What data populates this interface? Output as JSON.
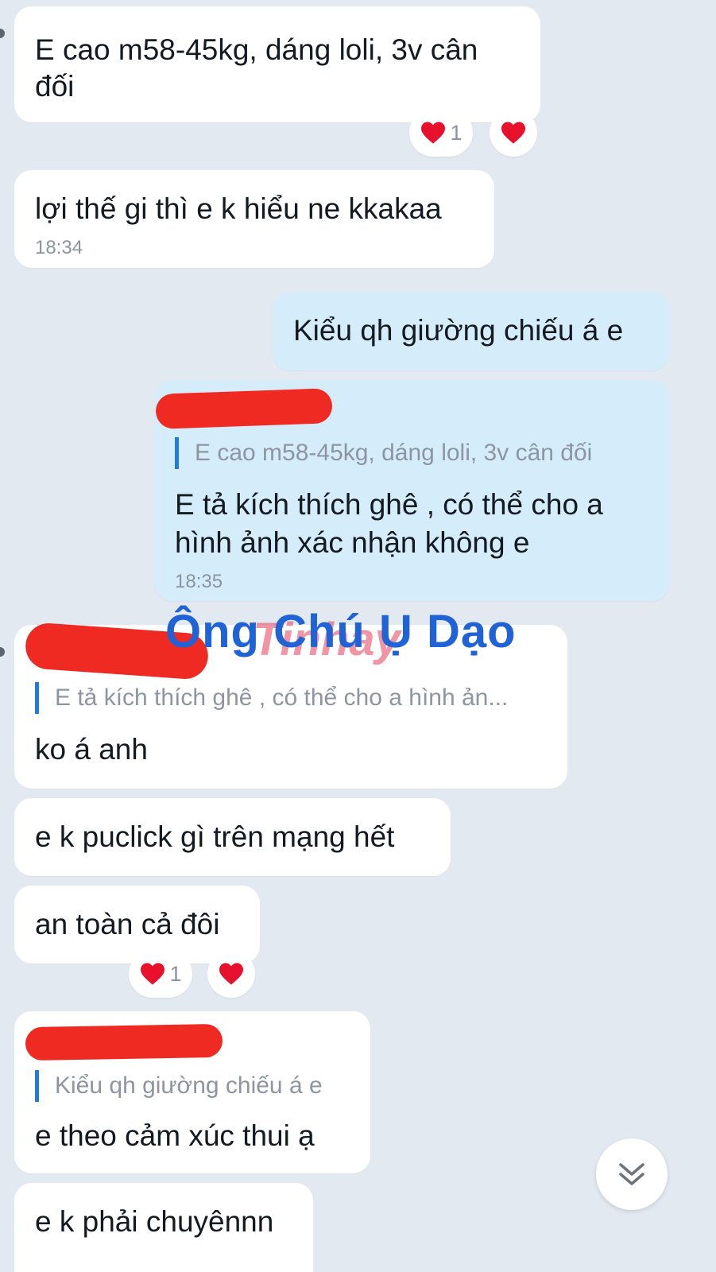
{
  "messages": [
    {
      "id": "m1",
      "direction": "incoming",
      "lines": [
        "E cao m58-45kg, dáng loli, 3v cân",
        "đối"
      ],
      "reactions": {
        "count_label": "1"
      }
    },
    {
      "id": "m2",
      "direction": "incoming",
      "text": "lợi thế gi thì e k hiểu ne kkakaa",
      "time": "18:34"
    },
    {
      "id": "m3",
      "direction": "outgoing",
      "text": "Kiểu qh giường chiếu á e"
    },
    {
      "id": "m4",
      "direction": "outgoing",
      "quote": "E cao m58-45kg, dáng loli, 3v cân đối",
      "lines": [
        "E tả kích thích ghê , có thể cho a",
        "hình ảnh xác nhận không e"
      ],
      "time": "18:35"
    },
    {
      "id": "m5",
      "direction": "incoming",
      "quote": "E tả kích thích ghê , có thể cho a hình ản...",
      "text": "ko á anh"
    },
    {
      "id": "m6",
      "direction": "incoming",
      "text": "e k puclick gì trên mạng hết"
    },
    {
      "id": "m7",
      "direction": "incoming",
      "text": "an toàn cả đôi",
      "reactions": {
        "count_label": "1"
      }
    },
    {
      "id": "m8",
      "direction": "incoming",
      "quote": "Kiểu qh giường chiếu á e",
      "text": "e theo cảm xúc thui ạ"
    },
    {
      "id": "m9",
      "direction": "incoming",
      "text": "e k phải chuyênnn"
    }
  ],
  "watermark": {
    "text": "Ông Chú Ụ Dạo",
    "ghost_text": "Tinhay"
  },
  "icons": {
    "reaction": "heart-icon",
    "scroll": "double-chevron-down-icon"
  },
  "colors": {
    "background": "#e2e9f1",
    "incoming_bubble": "#ffffff",
    "outgoing_bubble": "#d5ecfb",
    "quote_bar": "#1f7cde",
    "heart": "#e8112d",
    "redaction": "#ee2a22",
    "watermark": "#2063d6"
  }
}
